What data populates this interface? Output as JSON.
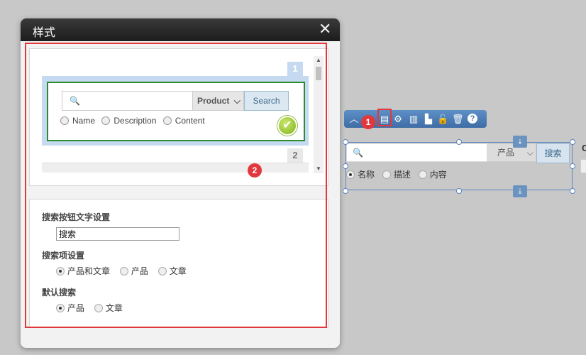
{
  "dialog": {
    "title": "样式",
    "close_glyph": "✕",
    "preview": {
      "style1_number": "1",
      "style2_number": "2",
      "search_glyph": "🔍",
      "select_label": "Product",
      "chevron_glyph": "⌵",
      "button_label": "Search",
      "radio_options": [
        "Name",
        "Description",
        "Content"
      ],
      "check_glyph": "✔",
      "scroll_up_glyph": "▲",
      "scroll_down_glyph": "▼"
    },
    "settings": {
      "button_text_title": "搜索按钮文字设置",
      "button_text_value": "搜索",
      "search_items_title": "搜索项设置",
      "search_items_options": [
        "产品和文章",
        "产品",
        "文章"
      ],
      "search_items_selected": 0,
      "default_search_title": "默认搜索",
      "default_search_options": [
        "产品",
        "文章"
      ],
      "default_search_selected": 0
    }
  },
  "annotations": {
    "marker1": "1",
    "marker2": "2",
    "color": "#e2383d"
  },
  "toolbar": {
    "icons": [
      "chevron-up-icon",
      "layout-icon",
      "gear-icon",
      "columns-icon",
      "chart-icon",
      "lock-icon",
      "trash-icon",
      "help-icon"
    ],
    "glyphs": {
      "up": "︿",
      "layout": "▤",
      "gear": "⚙",
      "columns": "▥",
      "chart": "▙",
      "lock": "🔓",
      "trash": "🗑",
      "help": "?"
    }
  },
  "widget": {
    "search_glyph": "🔍",
    "select_label": "产品",
    "chevron_glyph": "⌵",
    "button_label": "搜索",
    "radio_options": [
      "名称",
      "描述",
      "内容"
    ],
    "radio_selected": 0,
    "download_glyph": "⤓",
    "offscreen_letter": "C"
  }
}
